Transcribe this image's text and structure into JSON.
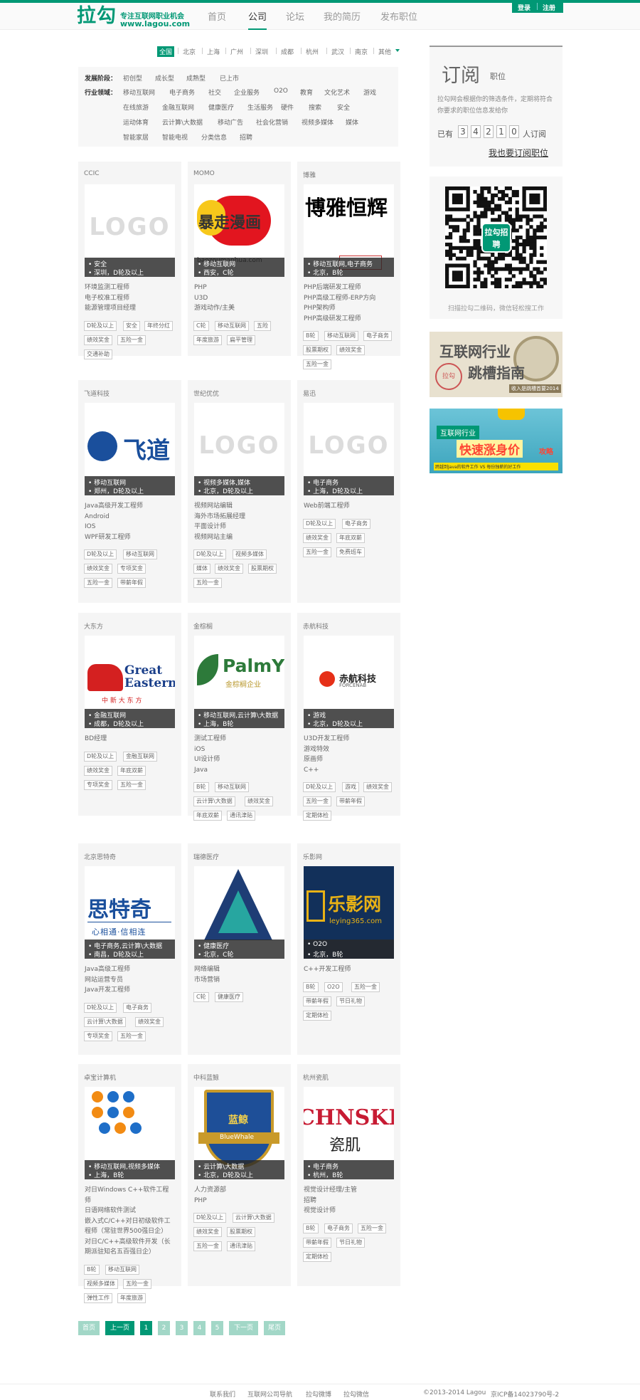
{
  "header": {
    "logo_text": "拉勾",
    "slogan": "专注互联网职业机会",
    "domain": "www.lagou.com",
    "nav": [
      "首页",
      "公司",
      "论坛",
      "我的简历",
      "发布职位"
    ],
    "login": "登录",
    "register": "注册"
  },
  "cities": [
    "全国",
    "北京",
    "上海",
    "广州",
    "深圳",
    "成都",
    "杭州",
    "武汉",
    "南京",
    "其他"
  ],
  "filters": {
    "stage_label": "发展阶段：",
    "stages": [
      "初创型",
      "成长型",
      "成熟型",
      "已上市"
    ],
    "industry_label": "行业领域：",
    "industries": [
      "移动互联网",
      "电子商务",
      "社交",
      "企业服务",
      "O2O",
      "教育",
      "文化艺术",
      "游戏",
      "在线旅游",
      "金融互联网",
      "健康医疗",
      "生活服务",
      "硬件",
      "搜索",
      "安全",
      "运动体育",
      "云计算\\大数据",
      "移动广告",
      "社会化营销",
      "视频多媒体",
      "媒体",
      "智能家居",
      "智能电视",
      "分类信息",
      "招聘"
    ]
  },
  "companies": [
    {
      "name": "CCIC",
      "logo": "LOGO",
      "line1": "安全",
      "line2": "深圳，D轮及以上",
      "jobs": [
        "环境监测工程师",
        "电子校准工程师",
        "能源管理项目经理"
      ],
      "tags": [
        "D轮及以上",
        "安全",
        "年终分红",
        "绩效奖金",
        "五险一金",
        "交通补助"
      ]
    },
    {
      "name": "MOMO",
      "logo": "暴走漫画",
      "logo_sub": "baozoumanhua.com",
      "line1": "移动互联网",
      "line2": "西安，C轮",
      "jobs": [
        "PHP",
        "U3D",
        "游戏动作/主美"
      ],
      "tags": [
        "C轮",
        "移动互联网",
        "五险",
        "年度旅游",
        "扁平管理"
      ]
    },
    {
      "name": "博雅",
      "logo": "博雅恒辉",
      "line1": "移动互联网,电子商务",
      "line2": "北京，B轮",
      "jobs": [
        "PHP后端研发工程师",
        "PHP高级工程师-ERP方向",
        "PHP架构师",
        "PHP高级研发工程师"
      ],
      "tags": [
        "B轮",
        "移动互联网",
        "电子商务",
        "股票期权",
        "绩效奖金",
        "五险一金"
      ]
    },
    {
      "name": "飞道科技",
      "logo": "飞道",
      "line1": "移动互联网",
      "line2": "郑州，D轮及以上",
      "jobs": [
        "Java高级开发工程师",
        "Android",
        "IOS",
        "WPF研发工程师"
      ],
      "tags": [
        "D轮及以上",
        "移动互联网",
        "绩效奖金",
        "专项奖金",
        "五险一金",
        "带薪年假"
      ]
    },
    {
      "name": "世纪优优",
      "logo": "LOGO",
      "line1": "视频多媒体,媒体",
      "line2": "北京，D轮及以上",
      "jobs": [
        "视频网站编辑",
        "海外市场拓展经理",
        "平面设计师",
        "视频网站主编"
      ],
      "tags": [
        "D轮及以上",
        "视频多媒体",
        "媒体",
        "绩效奖金",
        "股票期权",
        "五险一金"
      ]
    },
    {
      "name": "易迅",
      "logo": "LOGO",
      "line1": "电子商务",
      "line2": "上海，D轮及以上",
      "jobs": [
        "Web前端工程师"
      ],
      "tags": [
        "D轮及以上",
        "电子商务",
        "绩效奖金",
        "年底双薪",
        "五险一金",
        "免费班车"
      ]
    },
    {
      "name": "大东方",
      "logo": "Great Eastern",
      "logo_sub": "中 新 大 东 方",
      "line1": "金融互联网",
      "line2": "成都，D轮及以上",
      "jobs": [
        "BD经理"
      ],
      "tags": [
        "D轮及以上",
        "金融互联网",
        "绩效奖金",
        "年底双薪",
        "专项奖金",
        "五险一金"
      ]
    },
    {
      "name": "金棕榈",
      "logo": "PalmY",
      "logo_sub": "金棕榈企业",
      "line1": "移动互联网,云计算\\大数据",
      "line2": "上海，B轮",
      "jobs": [
        "测试工程师",
        "iOS",
        "UI设计师",
        "Java"
      ],
      "tags": [
        "B轮",
        "移动互联网",
        "云计算\\大数据",
        "绩效奖金",
        "年底双薪",
        "通讯津贴"
      ]
    },
    {
      "name": "赤航科技",
      "logo": "赤航科技",
      "logo_sub": "FORCENAB",
      "line1": "游戏",
      "line2": "北京，D轮及以上",
      "jobs": [
        "U3D开发工程师",
        "游戏特效",
        "原画师",
        "C++"
      ],
      "tags": [
        "D轮及以上",
        "游戏",
        "绩效奖金",
        "五险一金",
        "带薪年假",
        "定期体检"
      ]
    },
    {
      "name": "北京思特奇",
      "logo": "思特奇",
      "logo_sub": "心相通·信相连",
      "line1": "电子商务,云计算\\大数据",
      "line2": "南昌，D轮及以上",
      "jobs": [
        "Java高级工程师",
        "网站运营专员",
        "Java开发工程师"
      ],
      "tags": [
        "D轮及以上",
        "电子商务",
        "云计算\\大数据",
        "绩效奖金",
        "专项奖金",
        "五险一金"
      ]
    },
    {
      "name": "瑞德医疗",
      "logo": "",
      "line1": "健康医疗",
      "line2": "北京，C轮",
      "jobs": [
        "网络编辑",
        "市场营销"
      ],
      "tags": [
        "C轮",
        "健康医疗"
      ]
    },
    {
      "name": "乐影网",
      "logo": "乐影网",
      "logo_sub": "leying365.com",
      "line1": "O2O",
      "line2": "北京，B轮",
      "jobs": [
        "C++开发工程师"
      ],
      "tags": [
        "B轮",
        "O2O",
        "五险一金",
        "带薪年假",
        "节日礼物",
        "定期体检"
      ]
    },
    {
      "name": "卓宝计算机",
      "logo": "",
      "line1": "移动互联网,视频多媒体",
      "line2": "上海，B轮",
      "jobs": [
        "对日Windows C++软件工程",
        "师",
        "日语网络软件测试",
        "嵌入式C/C++对日初级软件工",
        "程师（常驻世界500强日企）",
        "对日C/C++高级软件开发（长",
        "期派驻知名五百强日企）"
      ],
      "tags": [
        "B轮",
        "移动互联网",
        "视频多媒体",
        "五险一金",
        "弹性工作",
        "年度旅游"
      ]
    },
    {
      "name": "中科蓝鲸",
      "logo": "蓝鲸",
      "logo_sub": "BlueWhale",
      "line1": "云计算\\大数据",
      "line2": "北京，D轮及以上",
      "jobs": [
        "人力资源部",
        "PHP"
      ],
      "tags": [
        "D轮及以上",
        "云计算\\大数据",
        "绩效奖金",
        "股票期权",
        "五险一金",
        "通讯津贴"
      ]
    },
    {
      "name": "杭州瓷肌",
      "logo": "CHNSKI",
      "logo_sub": "瓷肌",
      "line1": "电子商务",
      "line2": "杭州，B轮",
      "jobs": [
        "视觉设计经理/主管",
        "招聘",
        "视觉设计师"
      ],
      "tags": [
        "B轮",
        "电子商务",
        "五险一金",
        "带薪年假",
        "节日礼物",
        "定期体检"
      ]
    }
  ],
  "subscribe": {
    "title": "订阅",
    "subtitle": "职位",
    "desc": "拉勾网会根据你的筛选条件，定期将符合你要求的职位信息发给你",
    "prefix": "已有",
    "digits": [
      "3",
      "4",
      "2",
      "1",
      "0"
    ],
    "suffix": "人订阅",
    "link": "我也要订阅职位"
  },
  "qr": {
    "center": "拉勾招聘",
    "caption": "扫描拉勾二维码，微信轻松搜工作"
  },
  "banner1": {
    "title": "互联网行业",
    "sub": "跳槽指南",
    "stamp": "拉勾",
    "note": "收入是跳槽首要2014"
  },
  "banner2": {
    "title": "互联网行业",
    "sub": "快速涨身价",
    "end": "攻略",
    "note": "跨越到Java的软件工作 VS 每份独薪的好工作"
  },
  "pager": {
    "first": "首页",
    "prev": "上一页",
    "pages": [
      "1",
      "2",
      "3",
      "4",
      "5"
    ],
    "next": "下一页",
    "last": "尾页"
  },
  "footer": {
    "links": [
      "联系我们",
      "互联网公司导航",
      "拉勾微博",
      "拉勾微信"
    ],
    "copyright": "©2013-2014 Lagou",
    "icp": "京ICP备14023790号-2"
  },
  "colors": {
    "brand": "#019875",
    "pager_light": "#a2d7c7"
  }
}
